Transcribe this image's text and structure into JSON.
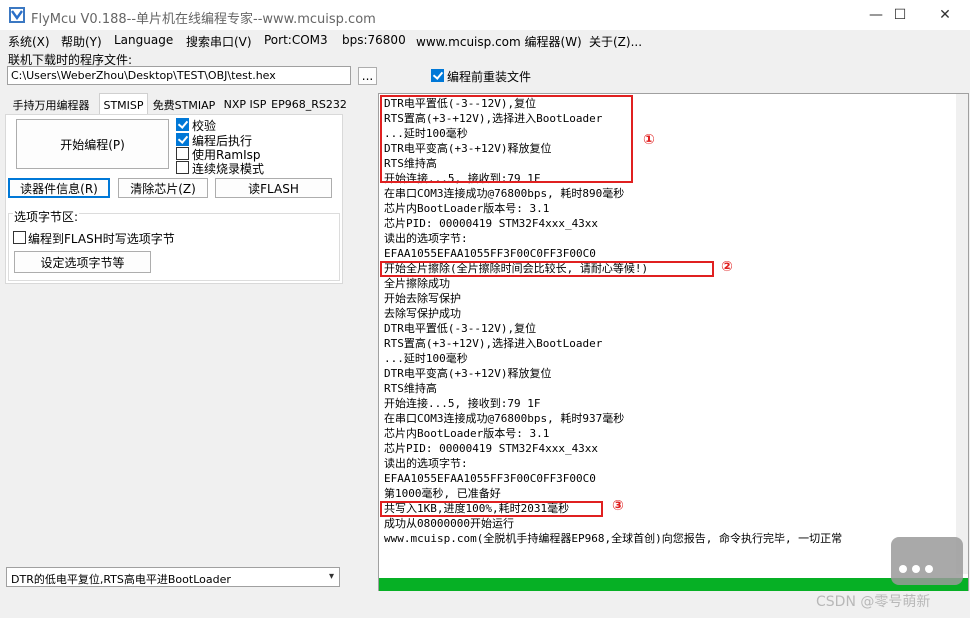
{
  "window": {
    "title": "FlyMcu V0.188--单片机在线编程专家--www.mcuisp.com",
    "minimize_glyph": "—",
    "maximize_glyph": "☐",
    "close_glyph": "✕"
  },
  "menu": [
    "系统(X)",
    "帮助(Y)",
    "Language",
    "搜索串口(V)",
    "Port:COM3",
    "bps:76800",
    "www.mcuisp.com 编程器(W)",
    "关于(Z)..."
  ],
  "file_section": {
    "label": "联机下载时的程序文件:",
    "path": "C:\\Users\\WeberZhou\\Desktop\\TEST\\OBJ\\test.hex",
    "browse_label": "...",
    "reload_label": "编程前重装文件",
    "reload_checked": true
  },
  "tabs": [
    {
      "label": "手持万用编程器",
      "active": false
    },
    {
      "label": "STMISP",
      "active": true
    },
    {
      "label": "免费STMIAP",
      "active": false
    },
    {
      "label": "NXP ISP",
      "active": false
    },
    {
      "label": "EP968_RS232",
      "active": false
    }
  ],
  "stmisp": {
    "start_button": "开始编程(P)",
    "options": [
      {
        "label": "校验",
        "checked": true
      },
      {
        "label": "编程后执行",
        "checked": true
      },
      {
        "label": "使用RamIsp",
        "checked": false
      },
      {
        "label": "连续烧录模式",
        "checked": false
      }
    ],
    "read_info_button": "读器件信息(R)",
    "clear_chip_button": "清除芯片(Z)",
    "read_flash_button": "读FLASH",
    "option_group_title": "选项字节区:",
    "write_option_label": "编程到FLASH时写选项字节",
    "write_option_checked": false,
    "set_option_button": "设定选项字节等"
  },
  "reset_mode": "DTR的低电平复位,RTS高电平进BootLoader",
  "log_lines": [
    "DTR电平置低(-3--12V),复位",
    "RTS置高(+3-+12V),选择进入BootLoader",
    "...延时100毫秒",
    "DTR电平变高(+3-+12V)释放复位",
    "RTS维持高",
    "开始连接...5, 接收到:79 1F",
    "在串口COM3连接成功@76800bps, 耗时890毫秒",
    "芯片内BootLoader版本号: 3.1",
    "芯片PID: 00000419  STM32F4xxx_43xx",
    "读出的选项字节:",
    "EFAA1055EFAA1055FF3F00C0FF3F00C0",
    "开始全片擦除(全片擦除时间会比较长, 请耐心等候!)",
    "全片擦除成功",
    "开始去除写保护",
    "去除写保护成功",
    "DTR电平置低(-3--12V),复位",
    "RTS置高(+3-+12V),选择进入BootLoader",
    "...延时100毫秒",
    "DTR电平变高(+3-+12V)释放复位",
    "RTS维持高",
    "开始连接...5, 接收到:79 1F",
    "在串口COM3连接成功@76800bps, 耗时937毫秒",
    "芯片内BootLoader版本号: 3.1",
    "芯片PID: 00000419  STM32F4xxx_43xx",
    "读出的选项字节:",
    "EFAA1055EFAA1055FF3F00C0FF3F00C0",
    "第1000毫秒, 已准备好",
    "共写入1KB,进度100%,耗时2031毫秒",
    "成功从08000000开始运行",
    "www.mcuisp.com(全脱机手持编程器EP968,全球首创)向您报告, 命令执行完毕, 一切正常"
  ],
  "annotations": [
    "①",
    "②",
    "③"
  ],
  "progress_fraction": 1.0,
  "watermark": "CSDN @零号萌新",
  "colors": {
    "accent": "#0078d7",
    "annotation": "#e02020",
    "progress": "#06b025"
  }
}
